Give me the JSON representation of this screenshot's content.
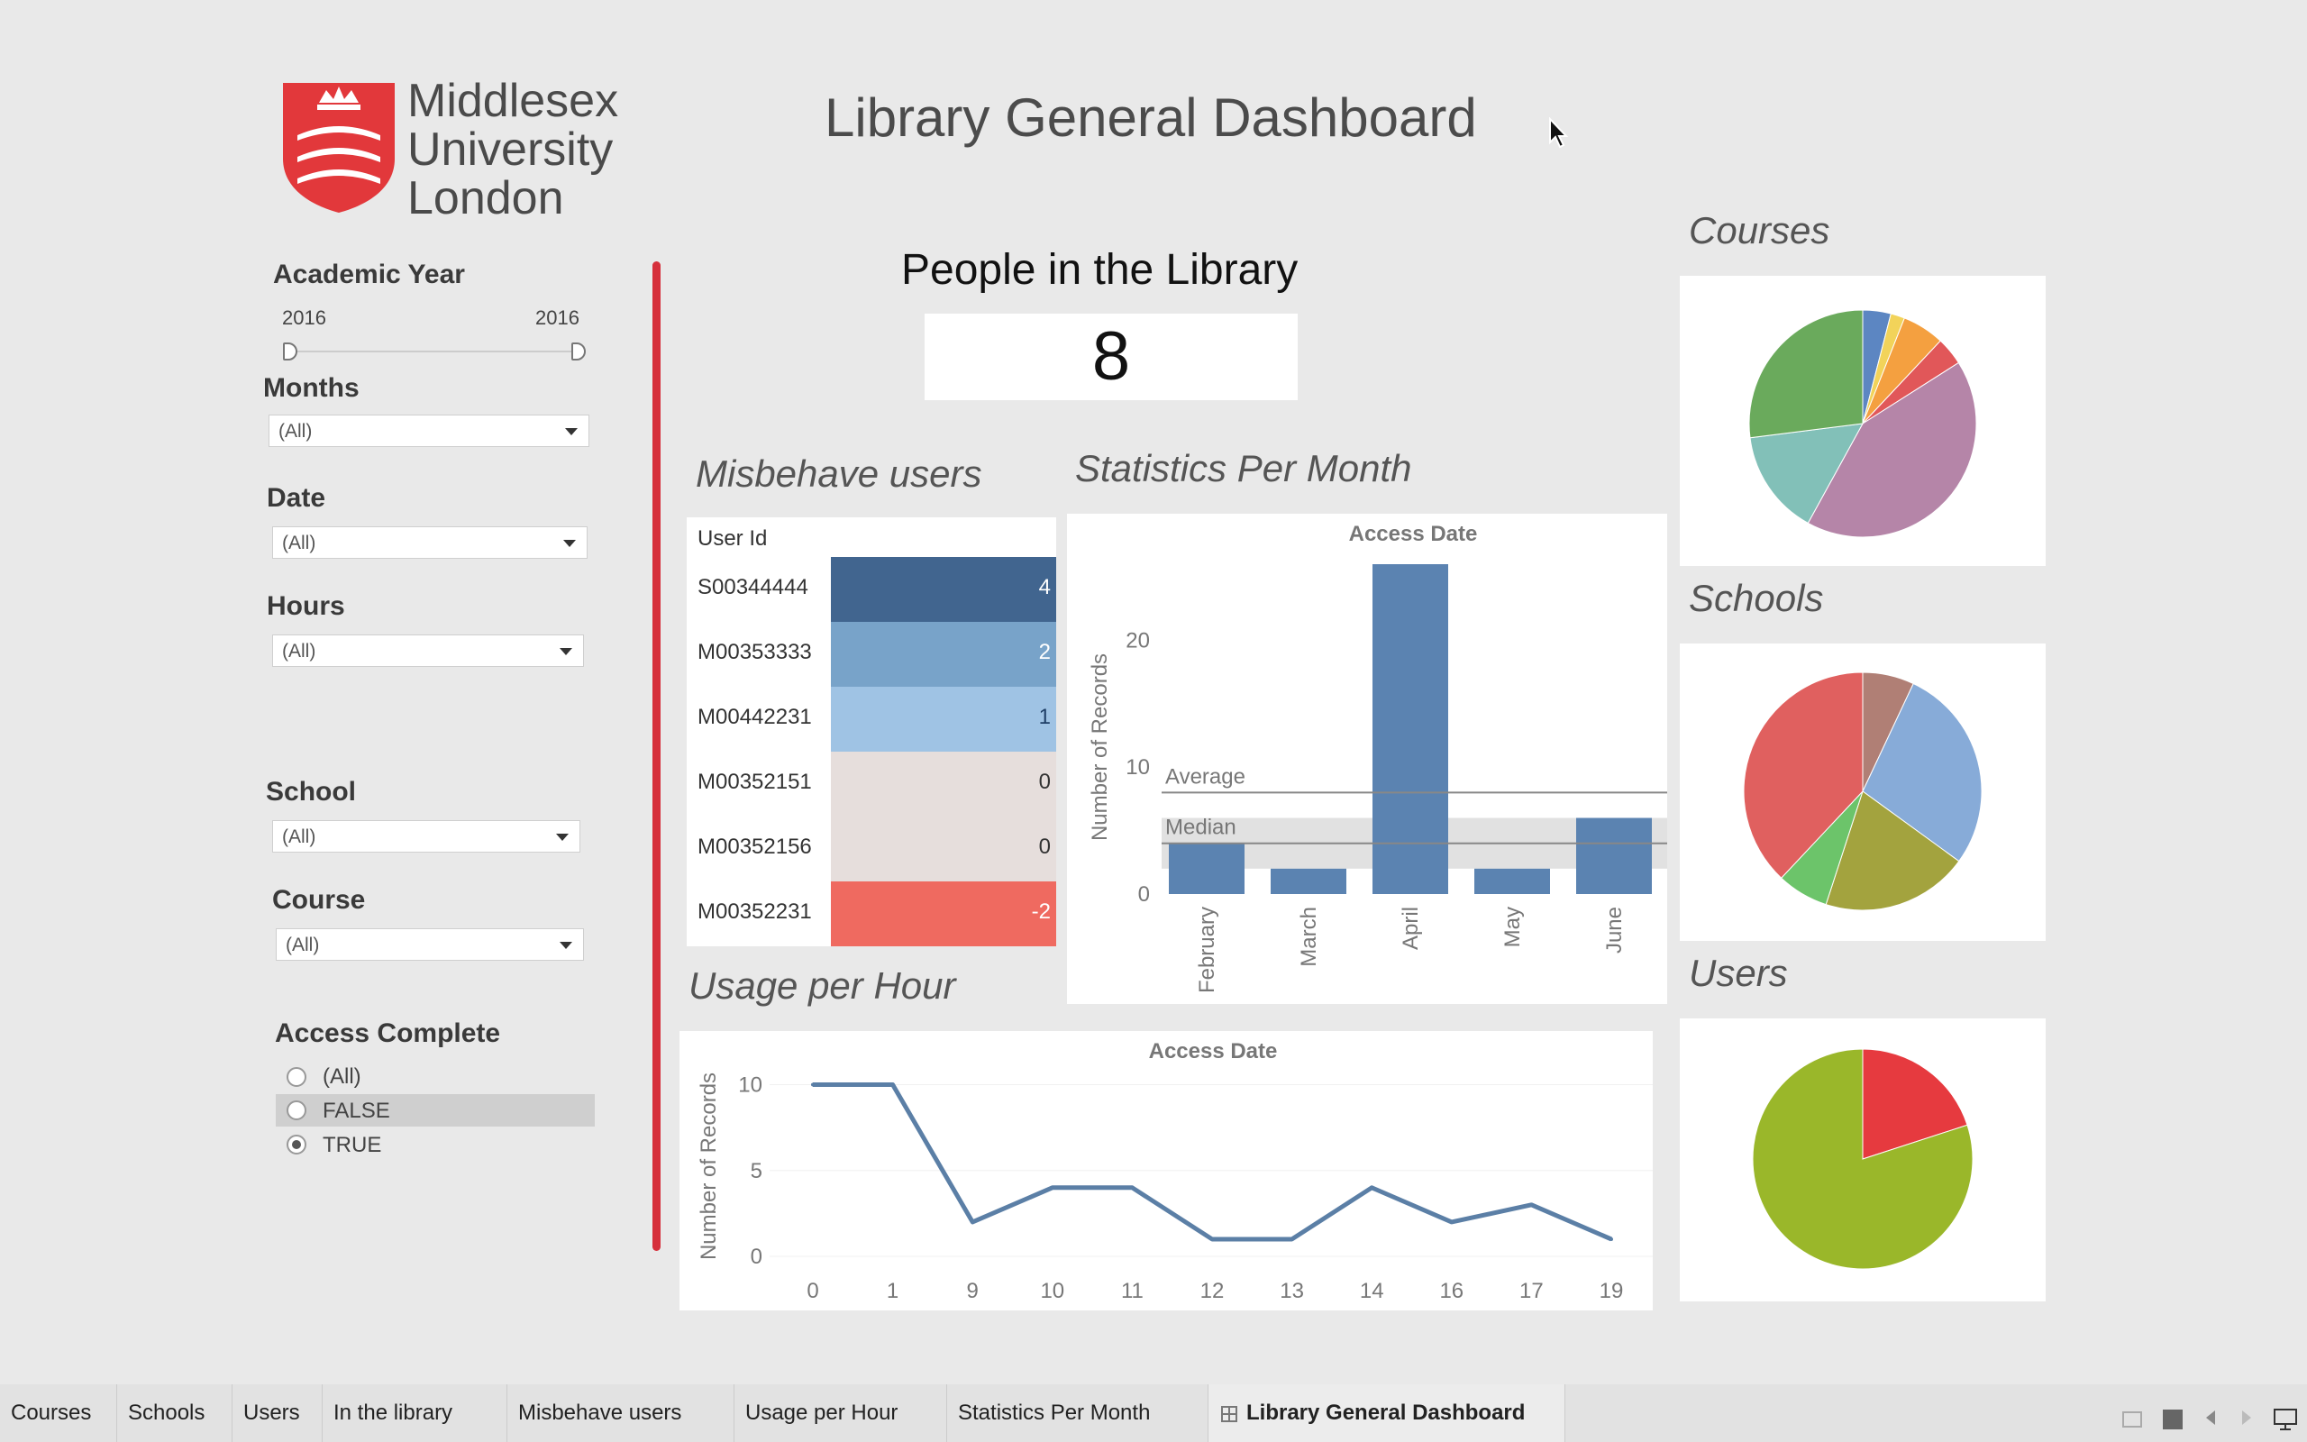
{
  "logo": {
    "line1": "Middlesex",
    "line2": "University",
    "line3": "London"
  },
  "dashboard_title": "Library General Dashboard",
  "filters": {
    "academic_year": {
      "label": "Academic Year",
      "from": "2016",
      "to": "2016"
    },
    "months": {
      "label": "Months",
      "value": "(All)"
    },
    "date": {
      "label": "Date",
      "value": "(All)"
    },
    "hours": {
      "label": "Hours",
      "value": "(All)"
    },
    "school": {
      "label": "School",
      "value": "(All)"
    },
    "course": {
      "label": "Course",
      "value": "(All)"
    },
    "access_complete": {
      "label": "Access Complete",
      "options": [
        "(All)",
        "FALSE",
        "TRUE"
      ],
      "selected": "TRUE"
    }
  },
  "people": {
    "title": "People in the Library",
    "value": "8"
  },
  "misbehave": {
    "title": "Misbehave users",
    "header": "User Id",
    "rows": [
      {
        "id": "S00344444",
        "value": "4",
        "color": "#41658f",
        "text": "#ffffff"
      },
      {
        "id": "M00353333",
        "value": "2",
        "color": "#78a3c9",
        "text": "#ffffff"
      },
      {
        "id": "M00442231",
        "value": "1",
        "color": "#9fc3e4",
        "text": "#1f3f66"
      },
      {
        "id": "M00352151",
        "value": "0",
        "color": "#e6dedc",
        "text": "#333333"
      },
      {
        "id": "M00352156",
        "value": "0",
        "color": "#e6dedc",
        "text": "#333333"
      },
      {
        "id": "M00352231",
        "value": "-2",
        "color": "#ef6a60",
        "text": "#ffffff"
      }
    ]
  },
  "statistics": {
    "title": "Statistics Per Month",
    "chart_data": {
      "type": "bar",
      "title": "Access Date",
      "ylabel": "Number of Records",
      "categories": [
        "February",
        "March",
        "April",
        "May",
        "June"
      ],
      "values": [
        4,
        2,
        26,
        2,
        6
      ],
      "ylim": [
        0,
        26
      ],
      "yticks": [
        "0",
        "10",
        "20"
      ],
      "reference_lines": [
        {
          "label": "Average",
          "value": 8
        },
        {
          "label": "Median",
          "value": 4
        }
      ],
      "color": "#5b83b1"
    }
  },
  "usage": {
    "title": "Usage per Hour",
    "chart_data": {
      "type": "line",
      "title": "Access Date",
      "ylabel": "Number of Records",
      "categories": [
        "0",
        "1",
        "9",
        "10",
        "11",
        "12",
        "13",
        "14",
        "16",
        "17",
        "19"
      ],
      "values": [
        10,
        10,
        2,
        4,
        4,
        1,
        1,
        4,
        2,
        3,
        1
      ],
      "ylim": [
        0,
        10.5
      ],
      "yticks": [
        "0",
        "5",
        "10"
      ],
      "color": "#5b7fa6"
    }
  },
  "pies": {
    "courses": {
      "title": "Courses",
      "chart_data": {
        "type": "pie",
        "values": [
          4,
          2,
          6,
          4,
          42,
          15,
          27
        ],
        "colors": [
          "#5c86c2",
          "#f2d35a",
          "#f4a040",
          "#e15759",
          "#b585a8",
          "#82c0b8",
          "#6aaa5c"
        ]
      }
    },
    "schools": {
      "title": "Schools",
      "chart_data": {
        "type": "pie",
        "values": [
          7,
          28,
          20,
          7,
          38
        ],
        "colors": [
          "#b07f75",
          "#87abd8",
          "#a3a33e",
          "#6cc46a",
          "#e0605f"
        ]
      }
    },
    "users": {
      "title": "Users",
      "chart_data": {
        "type": "pie",
        "values": [
          20,
          80
        ],
        "colors": [
          "#e63a3f",
          "#9ab72a"
        ]
      }
    }
  },
  "tabs": [
    "Courses",
    "Schools",
    "Users",
    "In the library",
    "Misbehave users",
    "Usage per Hour",
    "Statistics Per Month",
    "Library General Dashboard"
  ],
  "active_tab": "Library General Dashboard"
}
